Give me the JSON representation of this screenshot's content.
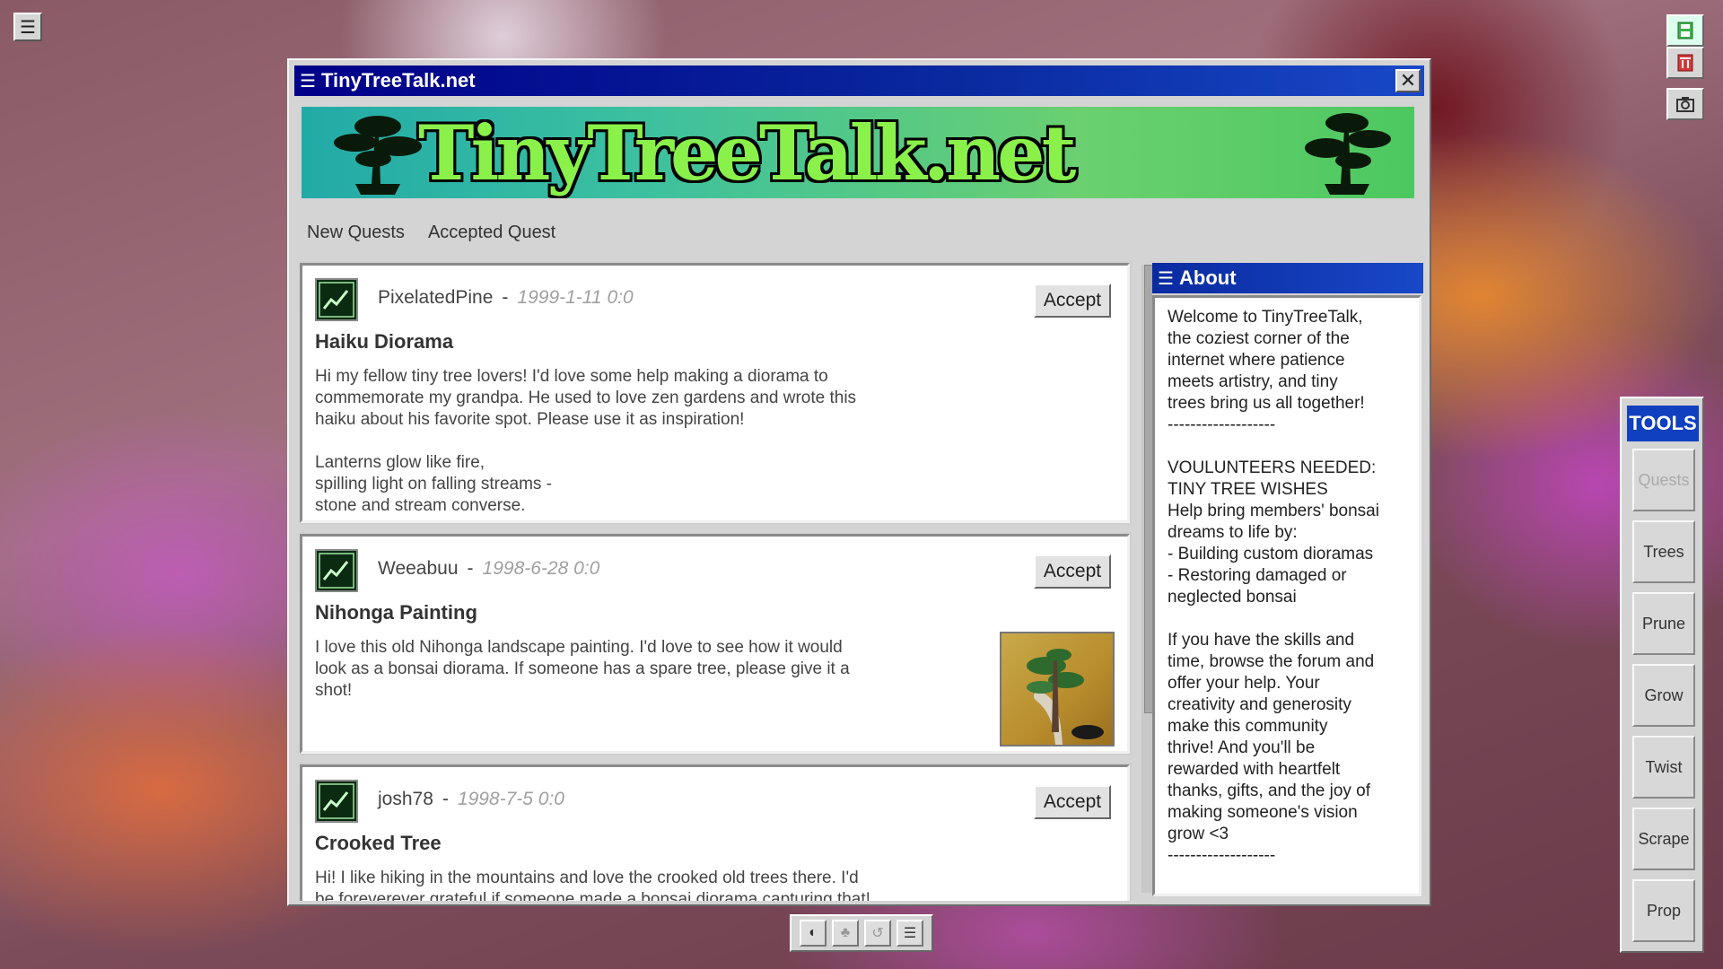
{
  "window": {
    "title": "TinyTreeTalk.net",
    "banner_text": "TinyTreeTalk.net",
    "close_glyph": "✕"
  },
  "nav": {
    "items": [
      {
        "label": "New Quests"
      },
      {
        "label": "Accepted Quest"
      }
    ]
  },
  "posts": [
    {
      "user": "PixelatedPine",
      "date": "1999-1-11 0:0",
      "title": "Haiku Diorama",
      "body": "Hi my fellow tiny tree lovers! I'd love some help making a diorama to\ncommemorate my grandpa. He used to love zen gardens and wrote this\nhaiku about his favorite spot. Please use it as inspiration!\n\nLanterns glow like fire,\nspilling light on falling streams -\nstone and stream converse.",
      "accept_label": "Accept",
      "has_image": false
    },
    {
      "user": "Weeabuu",
      "date": "1998-6-28 0:0",
      "title": "Nihonga Painting",
      "body": "I love this old Nihonga landscape painting. I'd love to see how it would\nlook as a bonsai diorama. If someone has a spare tree, please give it a\nshot!",
      "accept_label": "Accept",
      "has_image": true
    },
    {
      "user": "josh78",
      "date": "1998-7-5 0:0",
      "title": "Crooked Tree",
      "body": "Hi! I like hiking in the mountains and love the crooked old trees there. I'd\nbe foreverever grateful if someone made a bonsai diorama capturing that!",
      "accept_label": "Accept",
      "has_image": false
    }
  ],
  "about": {
    "title": "About",
    "text": "Welcome to TinyTreeTalk,\nthe coziest corner of the\ninternet where patience\nmeets artistry, and tiny\ntrees bring us all together!\n-------------------\n\nVOULUNTEERS NEEDED:\nTINY TREE WISHES\nHelp bring members' bonsai\ndreams to life by:\n- Building custom dioramas\n- Restoring damaged or\nneglected bonsai\n\nIf you have the skills and\ntime, browse the forum and\noffer your help. Your\ncreativity and generosity\nmake this community\nthrive! And you'll be\nrewarded with heartfelt\nthanks, gifts, and the joy of\nmaking someone's vision\ngrow <3\n-------------------"
  },
  "tools": {
    "title": "TOOLS",
    "items": [
      {
        "label": "Quests",
        "enabled": false
      },
      {
        "label": "Trees",
        "enabled": true
      },
      {
        "label": "Prune",
        "enabled": true
      },
      {
        "label": "Grow",
        "enabled": true
      },
      {
        "label": "Twist",
        "enabled": true
      },
      {
        "label": "Scrape",
        "enabled": true
      },
      {
        "label": "Prop",
        "enabled": true
      }
    ]
  },
  "icons": {
    "desktop_menu": "hamburger-icon",
    "side": [
      "save-icon",
      "trash-icon",
      "camera-icon"
    ],
    "taskbar": [
      "contrast-icon",
      "tree-icon",
      "undo-icon",
      "menu-icon"
    ]
  },
  "colors": {
    "title_bar": "#000088",
    "accent_blue": "#1040c0",
    "banner_green": "#8af04a"
  }
}
